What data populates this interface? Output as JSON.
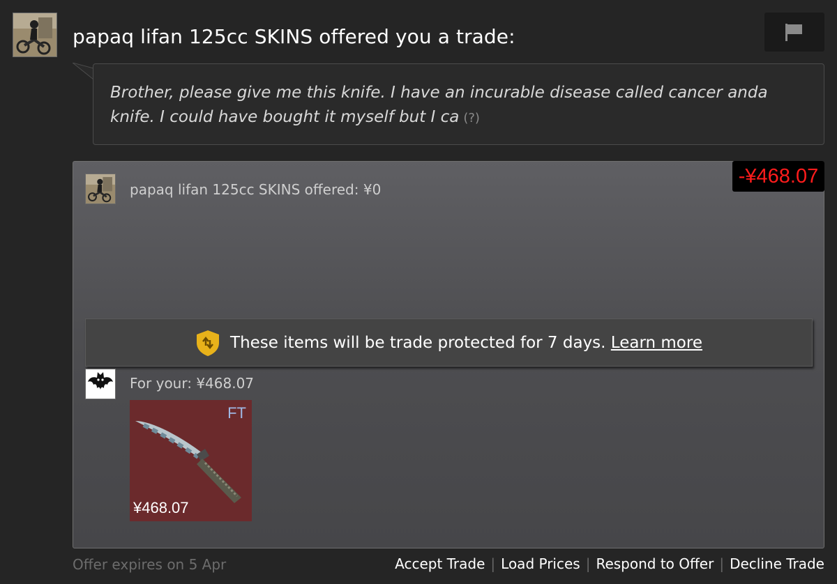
{
  "header": {
    "title": "papaq lifan 125cc SKINS offered you a trade:",
    "sender_avatar_icon": "biker-avatar-icon",
    "report_icon": "flag-icon"
  },
  "message": {
    "text": "Brother, please give me this knife. I have an incurable disease called cancer anda knife. I could have bought it myself but I ca",
    "more_label": "(?)"
  },
  "offer": {
    "value_diff": "-¥468.07",
    "value_color": "#ff1c1c",
    "their_items_label": "papaq lifan 125cc SKINS offered: ¥0",
    "protection": {
      "icon": "shield-icon",
      "text": "These items will be trade protected for 7 days.",
      "link": "Learn more"
    },
    "your_items_label": "For your: ¥468.07",
    "your_avatar_icon": "bat-avatar-icon",
    "items": [
      {
        "wear": "FT",
        "price": "¥468.07",
        "icon": "knife-icon",
        "tile_color": "#6b2a2c",
        "wear_color": "#9fb7e3"
      }
    ]
  },
  "footer": {
    "expires": "Offer expires on 5 Apr",
    "actions": {
      "accept": "Accept Trade",
      "load_prices": "Load Prices",
      "respond": "Respond to Offer",
      "decline": "Decline Trade"
    },
    "separator": "|"
  }
}
